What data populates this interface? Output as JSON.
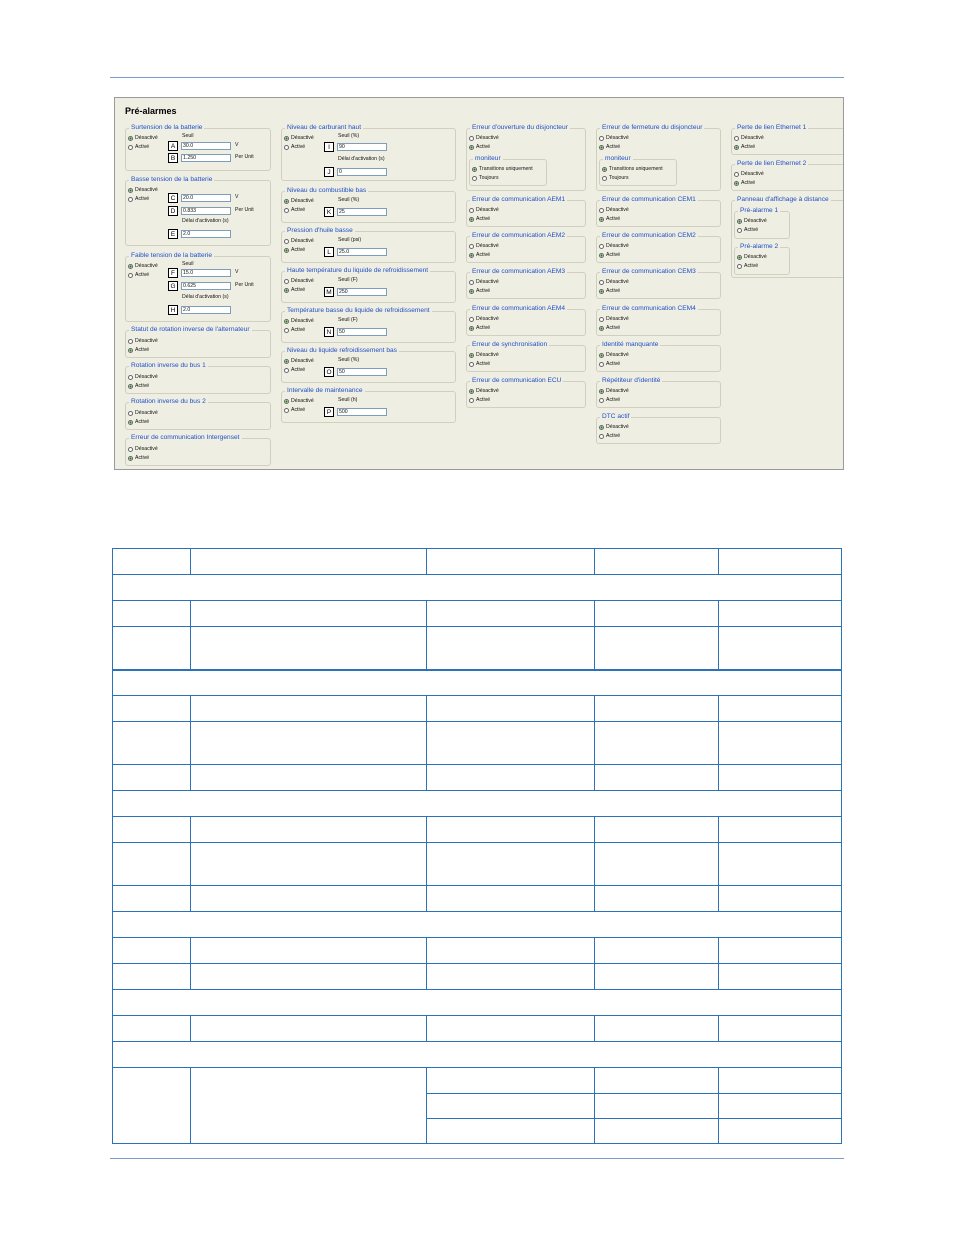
{
  "panel": {
    "title": "Pré-alarmes",
    "opt_off": "Désactivé",
    "opt_on": "Activé",
    "seuil": "Seuil",
    "seuil_pct": "Seuil (%)",
    "seuil_f": "Seuil (F)",
    "seuil_psi": "Seuil (psi)",
    "seuil_h": "Seuil (h)",
    "delai": "Délai d'activation (s)",
    "unit_v": "V",
    "unit_pu": "Per Unit",
    "moniteur": "moniteur",
    "transitions": "Transitions uniquement",
    "toujours": "Toujours"
  },
  "col1": {
    "surtension": {
      "title": "Surtension de la batterie",
      "key_a": "A",
      "val_a": "30.0",
      "key_b": "B",
      "val_b": "1.250"
    },
    "basse_tension": {
      "title": "Basse tension de la batterie",
      "key_c": "C",
      "val_c": "20.0",
      "key_d": "D",
      "val_d": "0.833",
      "key_e": "E",
      "val_e": "2.0"
    },
    "faible_tension": {
      "title": "Faible tension de la batterie",
      "key_f": "F",
      "val_f": "15.0",
      "key_g": "G",
      "val_g": "0.625",
      "key_h": "H",
      "val_h": "2.0"
    },
    "rotation_alt": {
      "title": "Statut de rotation inverse de l'alternateur"
    },
    "rotation_bus1": {
      "title": "Rotation inverse du bus 1"
    },
    "rotation_bus2": {
      "title": "Rotation inverse du bus 2"
    },
    "intergenset": {
      "title": "Erreur de communication Intergenset"
    }
  },
  "col2": {
    "carburant": {
      "title": "Niveau de carburant haut",
      "key_i": "I",
      "val_i": "90",
      "key_j": "J",
      "val_j": "0"
    },
    "combustible": {
      "title": "Niveau du combustible bas",
      "key_k": "K",
      "val_k": "25"
    },
    "huile": {
      "title": "Pression d'huile basse",
      "key_l": "L",
      "val_l": "25.0"
    },
    "haute_temp": {
      "title": "Haute température du liquide de refroidissement",
      "key_m": "M",
      "val_m": "250"
    },
    "basse_temp": {
      "title": "Température basse  du liquide de refroidissement",
      "key_n": "N",
      "val_n": "50"
    },
    "niveau_liquide": {
      "title": "Niveau du liquide refroidissement bas",
      "key_o": "O",
      "val_o": "50"
    },
    "maintenance": {
      "title": "Intervalle de maintenance",
      "key_p": "P",
      "val_p": "500"
    }
  },
  "col3": {
    "ouverture": "Erreur d'ouverture du disjoncteur",
    "aem1": "Erreur de communication AEM1",
    "aem2": "Erreur de communication AEM2",
    "aem3": "Erreur de communication AEM3",
    "aem4": "Erreur de communication AEM4",
    "synchro": "Erreur de synchronisation",
    "ecu": "Erreur de communication ECU"
  },
  "col4": {
    "fermeture": "Erreur de fermeture du disjoncteur",
    "cem1": "Erreur de communication CEM1",
    "cem2": "Erreur de communication CEM2",
    "cem3": "Erreur de communication CEM3",
    "cem4": "Erreur de communication CEM4",
    "identite": "Identité manquante",
    "repeteur": "Répétiteur d'identité",
    "dtc": "DTC actif"
  },
  "col5": {
    "eth1": "Perte de lien Ethernet 1",
    "eth2": "Perte de lien Ethernet 2",
    "panneau": "Panneau d'affichage à distance",
    "pre1": "Pré-alarme 1",
    "pre2": "Pré-alarme 2"
  }
}
